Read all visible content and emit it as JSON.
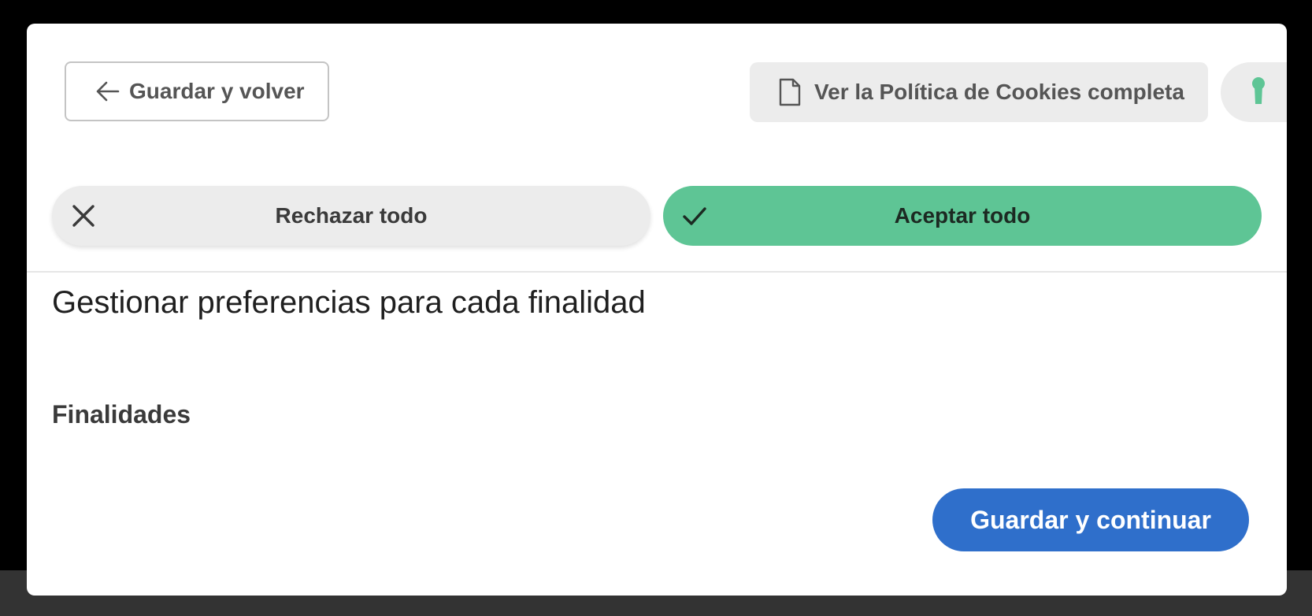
{
  "header": {
    "back_label": "Guardar y volver",
    "policy_label": "Ver la Política de Cookies completa"
  },
  "actions": {
    "reject_label": "Rechazar todo",
    "accept_label": "Aceptar todo"
  },
  "content": {
    "title": "Gestionar preferencias para cada finalidad",
    "purposes_heading": "Finalidades"
  },
  "footer": {
    "save_label": "Guardar y continuar"
  },
  "colors": {
    "accent_green": "#5ec595",
    "primary_blue": "#2f6fcb",
    "neutral_button": "#ececec"
  },
  "icons": {
    "back": "arrow-left-icon",
    "policy": "document-icon",
    "lock": "keyhole-icon",
    "reject": "close-icon",
    "accept": "check-icon"
  }
}
